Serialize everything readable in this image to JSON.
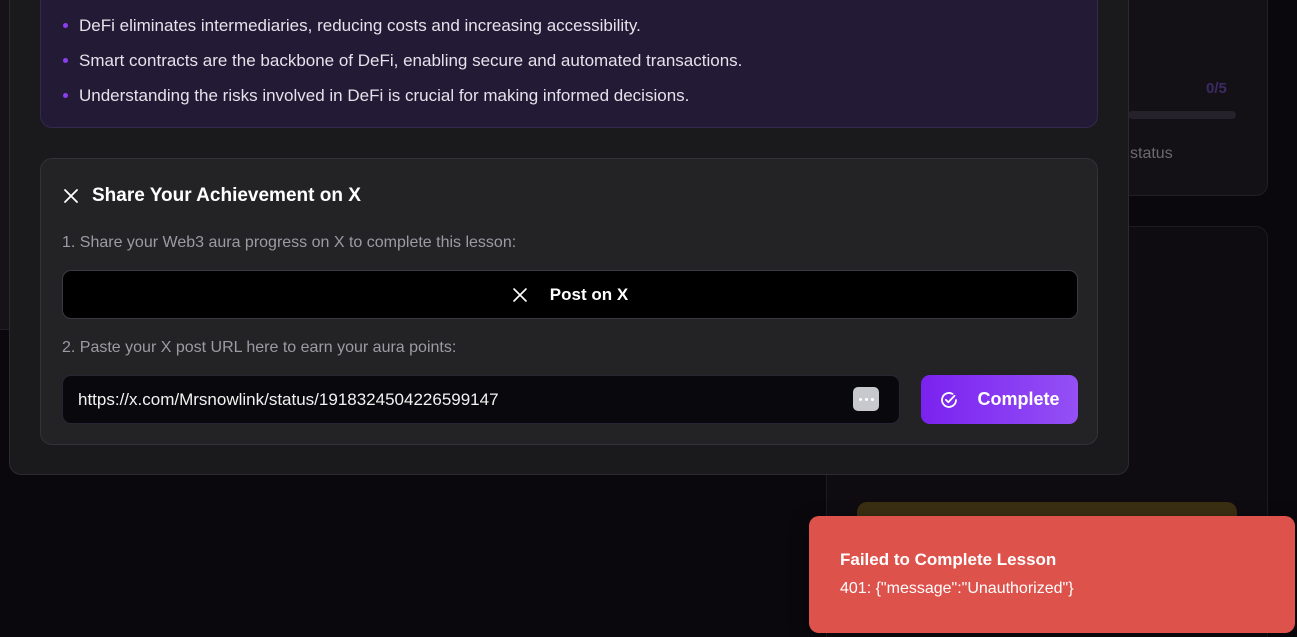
{
  "takeaways": [
    "DeFi eliminates intermediaries, reducing costs and increasing accessibility.",
    "Smart contracts are the backbone of DeFi, enabling secure and automated transactions.",
    "Understanding the risks involved in DeFi is crucial for making informed decisions."
  ],
  "share": {
    "title": "Share Your Achievement on X",
    "step1": "1. Share your Web3 aura progress on X to complete this lesson:",
    "post_button": "Post on X",
    "step2": "2. Paste your X post URL here to earn your aura points:",
    "url_value": "https://x.com/Mrsnowlink/status/1918324504226599147",
    "complete_button": "Complete"
  },
  "background": {
    "progress_count": "0/5",
    "status_text": "status"
  },
  "toast": {
    "title": "Failed to Complete Lesson",
    "message": "401: {\"message\":\"Unauthorized\"}"
  },
  "colors": {
    "accent": "#7a22f0",
    "toast_bg": "#de524c",
    "modal_bg": "#1a1a1d",
    "takeaways_bg": "#231a35"
  },
  "icons": {
    "share_title_icon": "x-logo-icon",
    "post_button_icon": "x-logo-icon",
    "input_icon": "password-manager-dots-icon",
    "complete_icon": "check-circle-icon"
  }
}
